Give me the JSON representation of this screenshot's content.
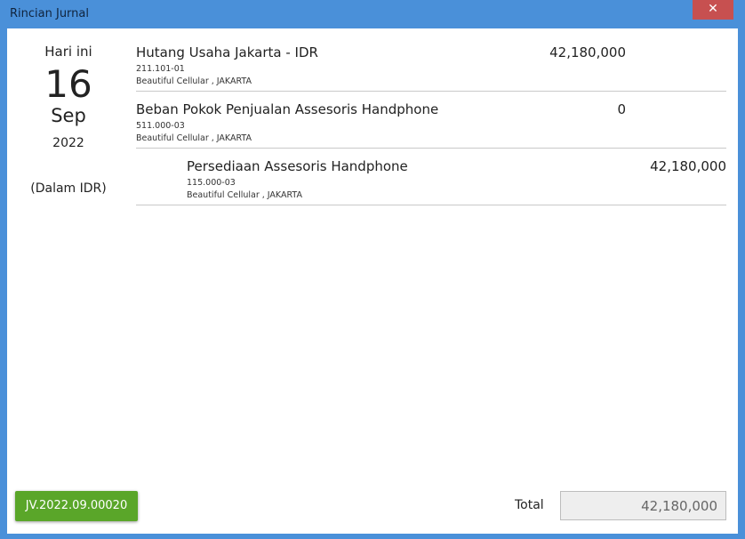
{
  "window": {
    "title": "Rincian Jurnal",
    "close_label": "✕"
  },
  "date": {
    "label_today": "Hari ini",
    "day": "16",
    "month": "Sep",
    "year": "2022",
    "currency_note": "(Dalam IDR)"
  },
  "entries": [
    {
      "account": "Hutang Usaha Jakarta - IDR",
      "code": "211.101-01",
      "branch": "Beautiful Cellular , JAKARTA",
      "debit": "42,180,000",
      "credit": ""
    },
    {
      "account": "Beban Pokok Penjualan Assesoris Handphone",
      "code": "511.000-03",
      "branch": "Beautiful Cellular , JAKARTA",
      "debit": "0",
      "credit": ""
    },
    {
      "account": "Persediaan Assesoris Handphone",
      "code": "115.000-03",
      "branch": "Beautiful Cellular , JAKARTA",
      "debit": "",
      "credit": "42,180,000"
    }
  ],
  "footer": {
    "journal_number": "JV.2022.09.00020",
    "total_label": "Total",
    "total_value": "42,180,000"
  }
}
